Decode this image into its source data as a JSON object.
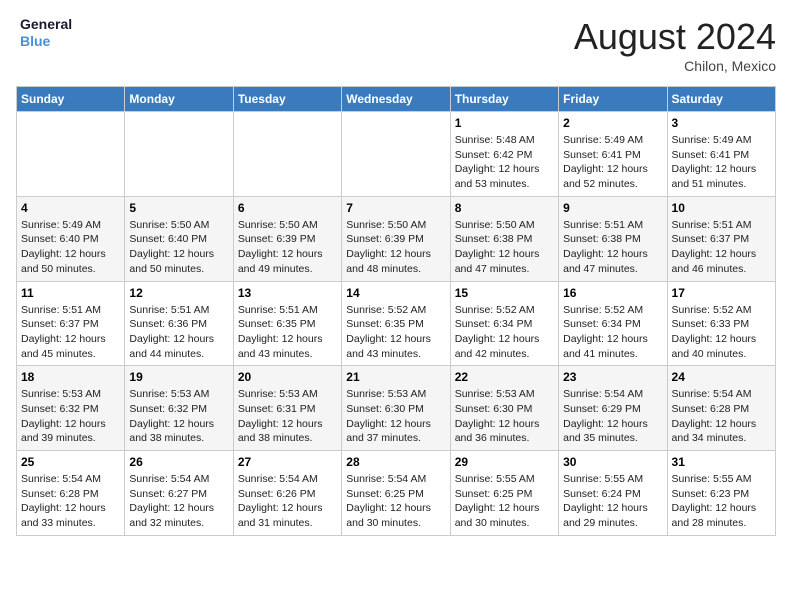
{
  "header": {
    "logo_line1": "General",
    "logo_line2": "Blue",
    "month_year": "August 2024",
    "location": "Chilon, Mexico"
  },
  "weekdays": [
    "Sunday",
    "Monday",
    "Tuesday",
    "Wednesday",
    "Thursday",
    "Friday",
    "Saturday"
  ],
  "weeks": [
    [
      {
        "day": "",
        "info": ""
      },
      {
        "day": "",
        "info": ""
      },
      {
        "day": "",
        "info": ""
      },
      {
        "day": "",
        "info": ""
      },
      {
        "day": "1",
        "info": "Sunrise: 5:48 AM\nSunset: 6:42 PM\nDaylight: 12 hours\nand 53 minutes."
      },
      {
        "day": "2",
        "info": "Sunrise: 5:49 AM\nSunset: 6:41 PM\nDaylight: 12 hours\nand 52 minutes."
      },
      {
        "day": "3",
        "info": "Sunrise: 5:49 AM\nSunset: 6:41 PM\nDaylight: 12 hours\nand 51 minutes."
      }
    ],
    [
      {
        "day": "4",
        "info": "Sunrise: 5:49 AM\nSunset: 6:40 PM\nDaylight: 12 hours\nand 50 minutes."
      },
      {
        "day": "5",
        "info": "Sunrise: 5:50 AM\nSunset: 6:40 PM\nDaylight: 12 hours\nand 50 minutes."
      },
      {
        "day": "6",
        "info": "Sunrise: 5:50 AM\nSunset: 6:39 PM\nDaylight: 12 hours\nand 49 minutes."
      },
      {
        "day": "7",
        "info": "Sunrise: 5:50 AM\nSunset: 6:39 PM\nDaylight: 12 hours\nand 48 minutes."
      },
      {
        "day": "8",
        "info": "Sunrise: 5:50 AM\nSunset: 6:38 PM\nDaylight: 12 hours\nand 47 minutes."
      },
      {
        "day": "9",
        "info": "Sunrise: 5:51 AM\nSunset: 6:38 PM\nDaylight: 12 hours\nand 47 minutes."
      },
      {
        "day": "10",
        "info": "Sunrise: 5:51 AM\nSunset: 6:37 PM\nDaylight: 12 hours\nand 46 minutes."
      }
    ],
    [
      {
        "day": "11",
        "info": "Sunrise: 5:51 AM\nSunset: 6:37 PM\nDaylight: 12 hours\nand 45 minutes."
      },
      {
        "day": "12",
        "info": "Sunrise: 5:51 AM\nSunset: 6:36 PM\nDaylight: 12 hours\nand 44 minutes."
      },
      {
        "day": "13",
        "info": "Sunrise: 5:51 AM\nSunset: 6:35 PM\nDaylight: 12 hours\nand 43 minutes."
      },
      {
        "day": "14",
        "info": "Sunrise: 5:52 AM\nSunset: 6:35 PM\nDaylight: 12 hours\nand 43 minutes."
      },
      {
        "day": "15",
        "info": "Sunrise: 5:52 AM\nSunset: 6:34 PM\nDaylight: 12 hours\nand 42 minutes."
      },
      {
        "day": "16",
        "info": "Sunrise: 5:52 AM\nSunset: 6:34 PM\nDaylight: 12 hours\nand 41 minutes."
      },
      {
        "day": "17",
        "info": "Sunrise: 5:52 AM\nSunset: 6:33 PM\nDaylight: 12 hours\nand 40 minutes."
      }
    ],
    [
      {
        "day": "18",
        "info": "Sunrise: 5:53 AM\nSunset: 6:32 PM\nDaylight: 12 hours\nand 39 minutes."
      },
      {
        "day": "19",
        "info": "Sunrise: 5:53 AM\nSunset: 6:32 PM\nDaylight: 12 hours\nand 38 minutes."
      },
      {
        "day": "20",
        "info": "Sunrise: 5:53 AM\nSunset: 6:31 PM\nDaylight: 12 hours\nand 38 minutes."
      },
      {
        "day": "21",
        "info": "Sunrise: 5:53 AM\nSunset: 6:30 PM\nDaylight: 12 hours\nand 37 minutes."
      },
      {
        "day": "22",
        "info": "Sunrise: 5:53 AM\nSunset: 6:30 PM\nDaylight: 12 hours\nand 36 minutes."
      },
      {
        "day": "23",
        "info": "Sunrise: 5:54 AM\nSunset: 6:29 PM\nDaylight: 12 hours\nand 35 minutes."
      },
      {
        "day": "24",
        "info": "Sunrise: 5:54 AM\nSunset: 6:28 PM\nDaylight: 12 hours\nand 34 minutes."
      }
    ],
    [
      {
        "day": "25",
        "info": "Sunrise: 5:54 AM\nSunset: 6:28 PM\nDaylight: 12 hours\nand 33 minutes."
      },
      {
        "day": "26",
        "info": "Sunrise: 5:54 AM\nSunset: 6:27 PM\nDaylight: 12 hours\nand 32 minutes."
      },
      {
        "day": "27",
        "info": "Sunrise: 5:54 AM\nSunset: 6:26 PM\nDaylight: 12 hours\nand 31 minutes."
      },
      {
        "day": "28",
        "info": "Sunrise: 5:54 AM\nSunset: 6:25 PM\nDaylight: 12 hours\nand 30 minutes."
      },
      {
        "day": "29",
        "info": "Sunrise: 5:55 AM\nSunset: 6:25 PM\nDaylight: 12 hours\nand 30 minutes."
      },
      {
        "day": "30",
        "info": "Sunrise: 5:55 AM\nSunset: 6:24 PM\nDaylight: 12 hours\nand 29 minutes."
      },
      {
        "day": "31",
        "info": "Sunrise: 5:55 AM\nSunset: 6:23 PM\nDaylight: 12 hours\nand 28 minutes."
      }
    ]
  ]
}
